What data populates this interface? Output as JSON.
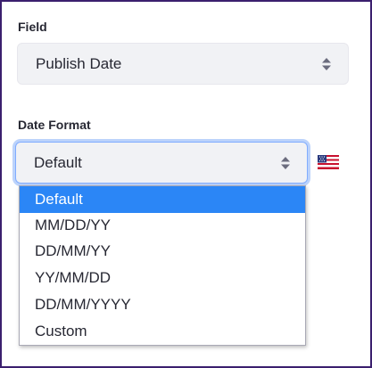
{
  "field": {
    "label": "Field",
    "value": "Publish Date",
    "icon": "updown-arrows-icon"
  },
  "date_format": {
    "label": "Date Format",
    "value": "Default",
    "icon": "updown-arrows-icon",
    "locale_icon": "us-flag-icon",
    "options": [
      {
        "label": "Default",
        "selected": true
      },
      {
        "label": "MM/DD/YY",
        "selected": false
      },
      {
        "label": "DD/MM/YY",
        "selected": false
      },
      {
        "label": "YY/MM/DD",
        "selected": false
      },
      {
        "label": "DD/MM/YYYY",
        "selected": false
      },
      {
        "label": "Custom",
        "selected": false
      }
    ]
  },
  "colors": {
    "selected_option": "#2b86f6",
    "focus_ring": "#80acff",
    "select_background": "#f1f2f5"
  }
}
